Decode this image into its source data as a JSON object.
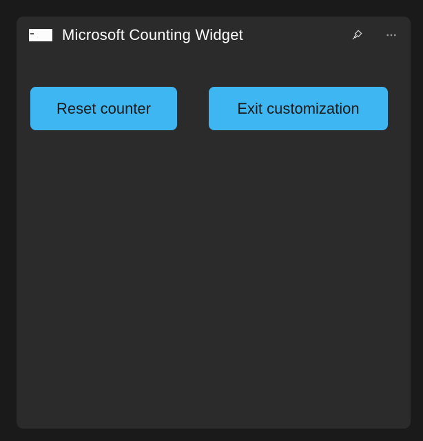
{
  "widget": {
    "title": "Microsoft Counting Widget"
  },
  "buttons": {
    "reset_label": "Reset counter",
    "exit_label": "Exit customization"
  },
  "colors": {
    "accent": "#3db6f2"
  }
}
